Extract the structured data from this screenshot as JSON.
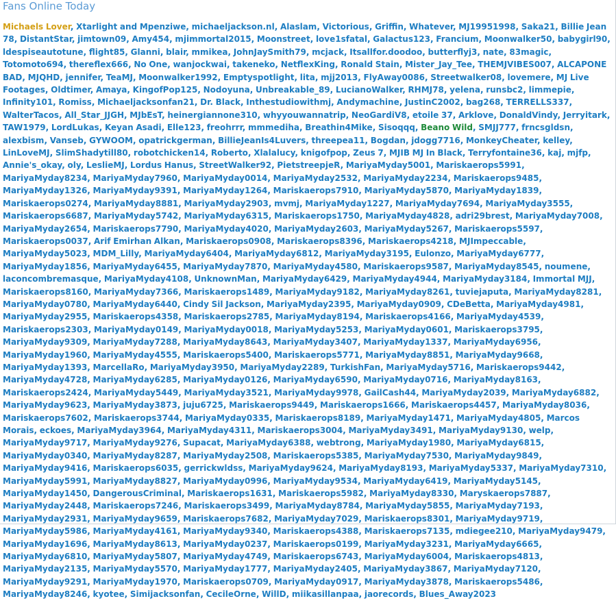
{
  "title": "Fans Online Today",
  "colors": {
    "title": "#5b9bd5",
    "link": "#1e7ec2",
    "highlight_gold": "#d4a017",
    "highlight_green": "#1f8a3a"
  },
  "users": [
    {
      "name": "Michaels Lover",
      "style": "gold"
    },
    {
      "name": "Xtarlight and Mpenziwe"
    },
    {
      "name": "michaeljackson.nl"
    },
    {
      "name": "Alaslam"
    },
    {
      "name": "Victorious"
    },
    {
      "name": "Griffin"
    },
    {
      "name": "Whatever"
    },
    {
      "name": "MJ19951998"
    },
    {
      "name": "Saka21"
    },
    {
      "name": "Billie Jean 78"
    },
    {
      "name": "DistantStar"
    },
    {
      "name": "jimtown09"
    },
    {
      "name": "Amy454"
    },
    {
      "name": "mjimmortal2015"
    },
    {
      "name": "Moonstreet"
    },
    {
      "name": "love1sfatal"
    },
    {
      "name": "Galactus123"
    },
    {
      "name": "Francium"
    },
    {
      "name": "Moonwalker50"
    },
    {
      "name": "babygirl90"
    },
    {
      "name": "ldespiseautotune"
    },
    {
      "name": "flight85"
    },
    {
      "name": "Glanni"
    },
    {
      "name": "blair"
    },
    {
      "name": "mmikea"
    },
    {
      "name": "JohnJaySmith79"
    },
    {
      "name": "mcjack"
    },
    {
      "name": "Itsallfor.doodoo"
    },
    {
      "name": "butterflyj3"
    },
    {
      "name": "nate"
    },
    {
      "name": "83magic"
    },
    {
      "name": "Totomoto694"
    },
    {
      "name": "thereflex666"
    },
    {
      "name": "No One"
    },
    {
      "name": "wanjockwai"
    },
    {
      "name": "takeneko"
    },
    {
      "name": "NetflexKing"
    },
    {
      "name": "Ronald Stain"
    },
    {
      "name": "Mister_Jay_Tee"
    },
    {
      "name": "THEMJVIBES007"
    },
    {
      "name": "ALCAPONE BAD"
    },
    {
      "name": "MJQHD"
    },
    {
      "name": "jennifer"
    },
    {
      "name": "TeaMJ"
    },
    {
      "name": "Moonwalker1992"
    },
    {
      "name": "Emptyspotlight"
    },
    {
      "name": "lita"
    },
    {
      "name": "mjj2013"
    },
    {
      "name": "FlyAway0086"
    },
    {
      "name": "Streetwalker08"
    },
    {
      "name": "lovemere"
    },
    {
      "name": "MJ Live Footages"
    },
    {
      "name": "Oldtimer"
    },
    {
      "name": "Amaya"
    },
    {
      "name": "KingofPop125"
    },
    {
      "name": "Nodoyuna"
    },
    {
      "name": "Unbreakable_89"
    },
    {
      "name": "LucianoWalker"
    },
    {
      "name": "RHMJ78"
    },
    {
      "name": "yelena"
    },
    {
      "name": "runsbc2"
    },
    {
      "name": "limmepie"
    },
    {
      "name": "Infinity101"
    },
    {
      "name": "Romiss"
    },
    {
      "name": "Michaeljacksonfan21"
    },
    {
      "name": "Dr. Black"
    },
    {
      "name": "Inthestudiowithmj"
    },
    {
      "name": "Andymachine"
    },
    {
      "name": "JustinC2002"
    },
    {
      "name": "bag268"
    },
    {
      "name": "TERRELLS337"
    },
    {
      "name": "WalterTacos"
    },
    {
      "name": "All_Star_JJGH"
    },
    {
      "name": "MJbEsT"
    },
    {
      "name": "heinergiannone310"
    },
    {
      "name": "whyyouwannatrip"
    },
    {
      "name": "NeoGardiV8"
    },
    {
      "name": "etoile 37"
    },
    {
      "name": "Arklove"
    },
    {
      "name": "DonaldVindy"
    },
    {
      "name": "Jerryitark"
    },
    {
      "name": "TAW1979"
    },
    {
      "name": "LordLukas"
    },
    {
      "name": "Keyan Asadi"
    },
    {
      "name": "Elle123"
    },
    {
      "name": "freohrrr"
    },
    {
      "name": "mmmediha"
    },
    {
      "name": "Breathin4Mike"
    },
    {
      "name": "Sisoqqq"
    },
    {
      "name": "Beano Wild",
      "style": "green"
    },
    {
      "name": "SMJJ777"
    },
    {
      "name": "frncsgldsn"
    },
    {
      "name": "alexbism"
    },
    {
      "name": "Vanseb"
    },
    {
      "name": "GYWOOM"
    },
    {
      "name": "opatrickgerman"
    },
    {
      "name": "BillieJeanIs4Luvers"
    },
    {
      "name": "threepea11"
    },
    {
      "name": "Bogdan"
    },
    {
      "name": "jdogg7716"
    },
    {
      "name": "MonkeyCheater"
    },
    {
      "name": "kelley"
    },
    {
      "name": "LinLoveMJ"
    },
    {
      "name": "SlimShadytill80"
    },
    {
      "name": "robotchicken14"
    },
    {
      "name": "Roberto"
    },
    {
      "name": "Xlalalucy"
    },
    {
      "name": "knigofpop"
    },
    {
      "name": "Zeus 7"
    },
    {
      "name": "MJIB MJ In Black"
    },
    {
      "name": "Terryfontaine36"
    },
    {
      "name": "kaj"
    },
    {
      "name": "mjfp"
    },
    {
      "name": "Annie's_okay"
    },
    {
      "name": "oly"
    },
    {
      "name": "LeslieMJ"
    },
    {
      "name": "Lordus Hanus"
    },
    {
      "name": "StreetWalker92"
    },
    {
      "name": "PietstreepjeR"
    },
    {
      "name": "MariyaMyday5001"
    },
    {
      "name": "Mariskaerops5991"
    },
    {
      "name": "MariyaMyday8234"
    },
    {
      "name": "MariyaMyday7960"
    },
    {
      "name": "MariyaMyday0014"
    },
    {
      "name": "MariyaMyday2532"
    },
    {
      "name": "MariyaMyday2234"
    },
    {
      "name": "Mariskaerops9485"
    },
    {
      "name": "MariyaMyday1326"
    },
    {
      "name": "MariyaMyday9391"
    },
    {
      "name": "MariyaMyday1264"
    },
    {
      "name": "Mariskaerops7910"
    },
    {
      "name": "MariyaMyday5870"
    },
    {
      "name": "MariyaMyday1839"
    },
    {
      "name": "Mariskaerops0274"
    },
    {
      "name": "MariyaMyday8881"
    },
    {
      "name": "MariyaMyday2903"
    },
    {
      "name": "mvmj"
    },
    {
      "name": "MariyaMyday1227"
    },
    {
      "name": "MariyaMyday7694"
    },
    {
      "name": "MariyaMyday3555"
    },
    {
      "name": "Mariskaerops6687"
    },
    {
      "name": "MariyaMyday5742"
    },
    {
      "name": "MariyaMyday6315"
    },
    {
      "name": "Mariskaerops1750"
    },
    {
      "name": "MariyaMyday4828"
    },
    {
      "name": "adri29brest"
    },
    {
      "name": "MariyaMyday7008"
    },
    {
      "name": "MariyaMyday2654"
    },
    {
      "name": "Mariskaerops7790"
    },
    {
      "name": "MariyaMyday4020"
    },
    {
      "name": "MariyaMyday2603"
    },
    {
      "name": "MariyaMyday5267"
    },
    {
      "name": "Mariskaerops5597"
    },
    {
      "name": "Mariskaerops0037"
    },
    {
      "name": "Arif Emirhan Alkan"
    },
    {
      "name": "Mariskaerops0908"
    },
    {
      "name": "Mariskaerops8396"
    },
    {
      "name": "Mariskaerops4218"
    },
    {
      "name": "MJImpeccable"
    },
    {
      "name": "MariyaMyday5023"
    },
    {
      "name": "MDM_Lilly"
    },
    {
      "name": "MariyaMyday6404"
    },
    {
      "name": "MariyaMyday6812"
    },
    {
      "name": "MariyaMyday3195"
    },
    {
      "name": "Eulonzo"
    },
    {
      "name": "MariyaMyday6777"
    },
    {
      "name": "MariyaMyday1856"
    },
    {
      "name": "MariyaMyday6455"
    },
    {
      "name": "MariyaMyday7870"
    },
    {
      "name": "MariyaMyday4580"
    },
    {
      "name": "Mariskaerops9587"
    },
    {
      "name": "MariyaMyday8545"
    },
    {
      "name": "noumene"
    },
    {
      "name": "laconcombremasque"
    },
    {
      "name": "MariyaMyday4108"
    },
    {
      "name": "UnknownMan"
    },
    {
      "name": "MariyaMyday6429"
    },
    {
      "name": "MariyaMyday4944"
    },
    {
      "name": "MariyaMyday3184"
    },
    {
      "name": "Immortal MJJ"
    },
    {
      "name": "Mariskaerops8160"
    },
    {
      "name": "MariyaMyday7366"
    },
    {
      "name": "Mariskaerops1489"
    },
    {
      "name": "MariyaMyday9182"
    },
    {
      "name": "MariyaMyday8261"
    },
    {
      "name": "tuviejaputa"
    },
    {
      "name": "MariyaMyday8281"
    },
    {
      "name": "MariyaMyday0780"
    },
    {
      "name": "MariyaMyday6440"
    },
    {
      "name": "Cindy Sil Jackson"
    },
    {
      "name": "MariyaMyday2395"
    },
    {
      "name": "MariyaMyday0909"
    },
    {
      "name": "CDeBetta"
    },
    {
      "name": "MariyaMyday4981"
    },
    {
      "name": "MariyaMyday2955"
    },
    {
      "name": "Mariskaerops4358"
    },
    {
      "name": "Mariskaerops2785"
    },
    {
      "name": "MariyaMyday8194"
    },
    {
      "name": "Mariskaerops4166"
    },
    {
      "name": "MariyaMyday4539"
    },
    {
      "name": "Mariskaerops2303"
    },
    {
      "name": "MariyaMyday0149"
    },
    {
      "name": "MariyaMyday0018"
    },
    {
      "name": "MariyaMyday5253"
    },
    {
      "name": "MariyaMyday0601"
    },
    {
      "name": "Mariskaerops3795"
    },
    {
      "name": "MariyaMyday9309"
    },
    {
      "name": "MariyaMyday7288"
    },
    {
      "name": "MariyaMyday8643"
    },
    {
      "name": "MariyaMyday3407"
    },
    {
      "name": "MariyaMyday1337"
    },
    {
      "name": "MariyaMyday6956"
    },
    {
      "name": "MariyaMyday1960"
    },
    {
      "name": "MariyaMyday4555"
    },
    {
      "name": "Mariskaerops5400"
    },
    {
      "name": "Mariskaerops5771"
    },
    {
      "name": "MariyaMyday8851"
    },
    {
      "name": "MariyaMyday9668"
    },
    {
      "name": "MariyaMyday1393"
    },
    {
      "name": "MarcellaRo"
    },
    {
      "name": "MariyaMyday3950"
    },
    {
      "name": "MariyaMyday2289"
    },
    {
      "name": "TurkishFan"
    },
    {
      "name": "MariyaMyday5716"
    },
    {
      "name": "Mariskaerops9442"
    },
    {
      "name": "MariyaMyday4728"
    },
    {
      "name": "MariyaMyday6285"
    },
    {
      "name": "MariyaMyday0126"
    },
    {
      "name": "MariyaMyday6590"
    },
    {
      "name": "MariyaMyday0716"
    },
    {
      "name": "MariyaMyday8163"
    },
    {
      "name": "Mariskaerops2424"
    },
    {
      "name": "MariyaMyday5449"
    },
    {
      "name": "MariyaMyday3521"
    },
    {
      "name": "MariyaMyday9978"
    },
    {
      "name": "GailCash44"
    },
    {
      "name": "MariyaMyday2039"
    },
    {
      "name": "MariyaMyday6882"
    },
    {
      "name": "MariyaMyday9623"
    },
    {
      "name": "MariyaMyday3873"
    },
    {
      "name": "juju6725"
    },
    {
      "name": "Mariskaerops9449"
    },
    {
      "name": "Mariskaerops1666"
    },
    {
      "name": "Mariskaerops4457"
    },
    {
      "name": "MariyaMyday8036"
    },
    {
      "name": "Mariskaerops7602"
    },
    {
      "name": "Mariskaerops3744"
    },
    {
      "name": "MariyaMyday0335"
    },
    {
      "name": "Mariskaerops8189"
    },
    {
      "name": "MariyaMyday1471"
    },
    {
      "name": "MariyaMyday4805"
    },
    {
      "name": "Marcos Morais"
    },
    {
      "name": "eckoes"
    },
    {
      "name": "MariyaMyday3964"
    },
    {
      "name": "MariyaMyday4311"
    },
    {
      "name": "Mariskaerops3004"
    },
    {
      "name": "MariyaMyday3491"
    },
    {
      "name": "MariyaMyday9130"
    },
    {
      "name": "welp"
    },
    {
      "name": "MariyaMyday9717"
    },
    {
      "name": "MariyaMyday9276"
    },
    {
      "name": "Supacat"
    },
    {
      "name": "MariyaMyday6388"
    },
    {
      "name": "webtrong"
    },
    {
      "name": "MariyaMyday1980"
    },
    {
      "name": "MariyaMyday6815"
    },
    {
      "name": "MariyaMyday0340"
    },
    {
      "name": "MariyaMyday8287"
    },
    {
      "name": "MariyaMyday2508"
    },
    {
      "name": "Mariskaerops5385"
    },
    {
      "name": "MariyaMyday7530"
    },
    {
      "name": "MariyaMyday9849"
    },
    {
      "name": "MariyaMyday9416"
    },
    {
      "name": "Mariskaerops6035"
    },
    {
      "name": "gerrickwldss"
    },
    {
      "name": "MariyaMyday9624"
    },
    {
      "name": "MariyaMyday8193"
    },
    {
      "name": "MariyaMyday5337"
    },
    {
      "name": "MariyaMyday7310"
    },
    {
      "name": "MariyaMyday5991"
    },
    {
      "name": "MariyaMyday8827"
    },
    {
      "name": "MariyaMyday0996"
    },
    {
      "name": "MariyaMyday9534"
    },
    {
      "name": "MariyaMyday6419"
    },
    {
      "name": "MariyaMyday5145"
    },
    {
      "name": "MariyaMyday1450"
    },
    {
      "name": "DangerousCriminal"
    },
    {
      "name": "Mariskaerops1631"
    },
    {
      "name": "Mariskaerops5982"
    },
    {
      "name": "MariyaMyday8330"
    },
    {
      "name": "Maryskaerops7887"
    },
    {
      "name": "MariyaMyday2448"
    },
    {
      "name": "Mariskaerops7246"
    },
    {
      "name": "Mariskaerops3499"
    },
    {
      "name": "MariyaMyday8784"
    },
    {
      "name": "MariyaMyday5855"
    },
    {
      "name": "MariyaMyday7193"
    },
    {
      "name": "MariyaMyday2931"
    },
    {
      "name": "MariyaMyday9659"
    },
    {
      "name": "Mariskaerops7682"
    },
    {
      "name": "MariyaMyday7029"
    },
    {
      "name": "Mariskaerops8301"
    },
    {
      "name": "MariyaMyday9719"
    },
    {
      "name": "MariyaMyday5986"
    },
    {
      "name": "MariyaMyday4161"
    },
    {
      "name": "MariyaMyday9340"
    },
    {
      "name": "Mariskaerops4388"
    },
    {
      "name": "Mariskaerops7135"
    },
    {
      "name": "mdiegee210"
    },
    {
      "name": "MariyaMyday9479"
    },
    {
      "name": "MariyaMyday1696"
    },
    {
      "name": "MariyaMyday8613"
    },
    {
      "name": "MariyaMyday0237"
    },
    {
      "name": "Mariskaerops0199"
    },
    {
      "name": "MariyaMyday3231"
    },
    {
      "name": "MariyaMyday6665"
    },
    {
      "name": "MariyaMyday6810"
    },
    {
      "name": "MariyaMyday5807"
    },
    {
      "name": "MariyaMyday4749"
    },
    {
      "name": "Mariskaerops6743"
    },
    {
      "name": "MariyaMyday6004"
    },
    {
      "name": "Mariskaerops4813"
    },
    {
      "name": "MariyaMyday2135"
    },
    {
      "name": "MariyaMyday5570"
    },
    {
      "name": "MariyaMyday1777"
    },
    {
      "name": "MariyaMyday2405"
    },
    {
      "name": "MariyaMyday3867"
    },
    {
      "name": "MariyaMyday7120"
    },
    {
      "name": "MariyaMyday9291"
    },
    {
      "name": "MariyaMyday1970"
    },
    {
      "name": "Mariskaerops0709"
    },
    {
      "name": "MariyaMyday0917"
    },
    {
      "name": "MariyaMyday3878"
    },
    {
      "name": "Mariskaerops5486"
    },
    {
      "name": "MariyaMyday8246"
    },
    {
      "name": "kyotee"
    },
    {
      "name": "Simijacksonfan"
    },
    {
      "name": "CecileOrne"
    },
    {
      "name": "WillD"
    },
    {
      "name": "miikasillanpaa"
    },
    {
      "name": "jaorecords"
    },
    {
      "name": "Blues_Away2023"
    }
  ]
}
